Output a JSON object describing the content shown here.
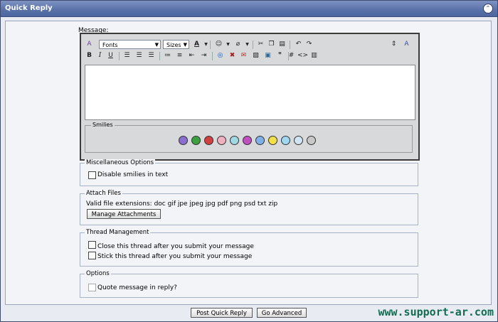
{
  "header": {
    "title": "Quick Reply"
  },
  "editor": {
    "message_label": "Message:",
    "fonts_label": "Fonts",
    "sizes_label": "Sizes",
    "smilies_legend": "Smilies",
    "smilies": [
      "purple",
      "green",
      "red",
      "pink",
      "teal",
      "magenta",
      "blue",
      "yellow",
      "cyan",
      "cool",
      "grey"
    ]
  },
  "misc": {
    "legend": "Miscellaneous Options",
    "disable_smilies": "Disable smilies in text"
  },
  "attach": {
    "legend": "Attach Files",
    "extensions": "Valid file extensions: doc gif jpe jpeg jpg pdf png psd txt zip",
    "manage_button": "Manage Attachments"
  },
  "thread": {
    "legend": "Thread Management",
    "close_option": "Close this thread after you submit your message",
    "stick_option": "Stick this thread after you submit your message"
  },
  "options": {
    "legend": "Options",
    "quote": "Quote message in reply?"
  },
  "actions": {
    "post_button": "Post Quick Reply",
    "advanced_button": "Go Advanced"
  },
  "watermark": "www.support-ar.com"
}
